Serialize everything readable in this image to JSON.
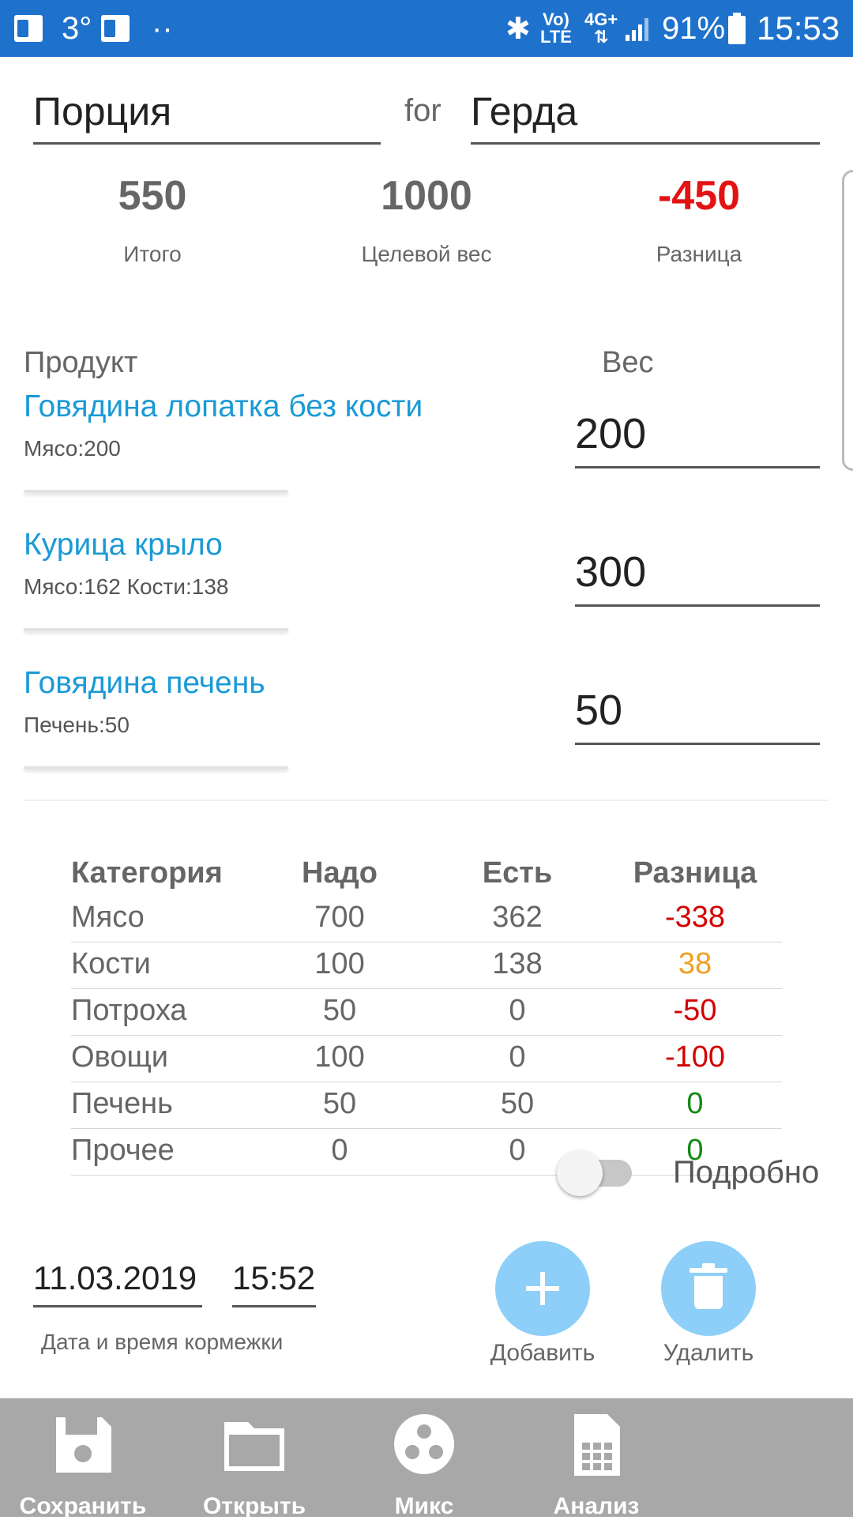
{
  "statusbar": {
    "temperature": "3°",
    "dots": "··",
    "volte_top": "Vo)",
    "volte_bottom": "LTE",
    "net_top": "4G+",
    "net_bottom": "⇅",
    "battery": "91%",
    "time": "15:53"
  },
  "header": {
    "portion_value": "Порция",
    "for_label": "for",
    "pet_value": "Герда"
  },
  "summary": {
    "total_value": "550",
    "total_label": "Итого",
    "target_value": "1000",
    "target_label": "Целевой вес",
    "diff_value": "-450",
    "diff_label": "Разница",
    "diff_color": "#e31313"
  },
  "products": {
    "product_header": "Продукт",
    "weight_header": "Вес",
    "items": [
      {
        "name": "Говядина лопатка без кости",
        "details": "Мясо:200",
        "weight": "200"
      },
      {
        "name": "Курица крыло",
        "details": "Мясо:162 Кости:138",
        "weight": "300"
      },
      {
        "name": "Говядина печень",
        "details": "Печень:50",
        "weight": "50"
      }
    ]
  },
  "categories": {
    "headers": [
      "Категория",
      "Надо",
      "Есть",
      "Разница"
    ],
    "rows": [
      {
        "name": "Мясо",
        "need": "700",
        "have": "362",
        "diff": "-338",
        "diff_color": "#d40000"
      },
      {
        "name": "Кости",
        "need": "100",
        "have": "138",
        "diff": "38",
        "diff_color": "#f0a020"
      },
      {
        "name": "Потроха",
        "need": "50",
        "have": "0",
        "diff": "-50",
        "diff_color": "#d40000"
      },
      {
        "name": "Овощи",
        "need": "100",
        "have": "0",
        "diff": "-100",
        "diff_color": "#d40000"
      },
      {
        "name": "Печень",
        "need": "50",
        "have": "50",
        "diff": "0",
        "diff_color": "#138a13"
      },
      {
        "name": "Прочее",
        "need": "0",
        "have": "0",
        "diff": "0",
        "diff_color": "#138a13"
      }
    ]
  },
  "details_toggle": {
    "label": "Подробно",
    "on": false
  },
  "feeding": {
    "date": "11.03.2019",
    "time": "15:52",
    "caption": "Дата и время кормежки"
  },
  "actions": {
    "add_label": "Добавить",
    "delete_label": "Удалить",
    "fab_color": "#8dcff8"
  },
  "bottom_nav": {
    "save": "Сохранить",
    "open": "Открыть",
    "mix": "Микс",
    "analysis": "Анализ"
  },
  "colors": {
    "statusbar": "#1f72cc",
    "product_link": "#1a9ad6",
    "nav_bg": "#a8a8a8"
  }
}
